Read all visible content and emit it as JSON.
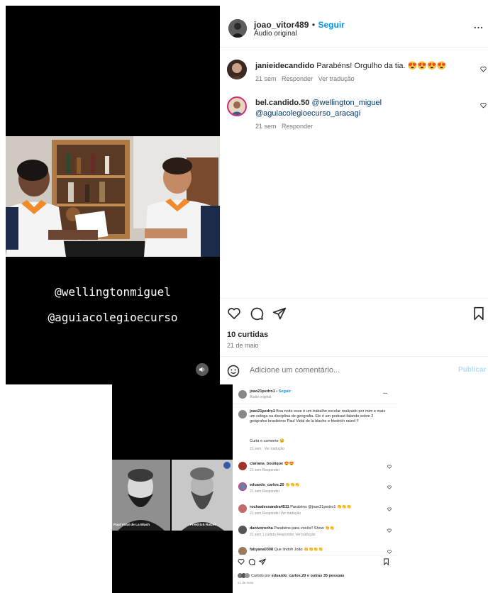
{
  "top_post": {
    "username": "joao_vitor489",
    "separator": "•",
    "follow_label": "Seguir",
    "audio": "Áudio original",
    "more": "...",
    "comments": [
      {
        "user": "janieidecandido",
        "text": "Parabéns! Orgulho da tia.",
        "emojis": "😍😍😍😍",
        "time": "21 sem",
        "reply": "Responder",
        "translate": "Ver tradução"
      },
      {
        "user": "bel.candido.50",
        "mention1": "@wellington_miguel",
        "mention2": "@aguiacolegioecurso_aracagi",
        "time": "21 sem",
        "reply": "Responder"
      }
    ],
    "video_captions": [
      "@wellingtonmiguel",
      "@aguiacolegioecurso"
    ],
    "likes": "10 curtidas",
    "date": "21 de maio",
    "add_comment_placeholder": "Adicione um comentário...",
    "publish_label": "Publicar",
    "icons": {
      "like": "heart-icon",
      "comment": "comment-icon",
      "share": "send-icon",
      "save": "bookmark-icon",
      "emoji": "smiley-icon",
      "sound": "speaker-icon"
    }
  },
  "bottom_post": {
    "username": "joao21pedro1",
    "separator": "•",
    "follow_label": "Seguir",
    "audio": "Áudio original",
    "more": "...",
    "portrait_labels": [
      "Paul Vidal de La Blach",
      "Friedrich Ratzel"
    ],
    "caption_user": "joao21pedro1",
    "caption_text": "Boa noite esse é um trabalho escolar realizado por mim e mais um colega na disciplina de geografia. Ele é um podcast falando sobre 2 geógrafos brasileiros Paul Vidal de la blache e friedrich ratzel !!",
    "caption_cta": "Curta e comente 😊",
    "caption_time": "21 sem",
    "caption_translate": "Ver tradução",
    "comments": [
      {
        "user": "clariana_boutique",
        "text": "😍😍",
        "meta": "21 sem   Responder"
      },
      {
        "user": "eduardo_carlos.20",
        "text": "👏👏👏",
        "meta": "21 sem   Responder"
      },
      {
        "user": "rochaalessandra4511",
        "text": "Parabéns @joao21pedro1 👏👏👏",
        "meta": "21 sem   Responder   Ver tradução"
      },
      {
        "user": "danivorocha",
        "text": "Parabéns para vocês!! Show 👏👏",
        "meta": "21 sem   1 curtida   Responder   Ver tradução"
      },
      {
        "user": "fabyana0308",
        "text": "Que lindoh João 👏👏👏👏",
        "meta": ""
      }
    ],
    "liked_prefix": "Curtido por",
    "liked_user": "eduardo_carlos.20",
    "liked_suffix": "e outras 35 pessoas",
    "date": "21 de maio"
  }
}
